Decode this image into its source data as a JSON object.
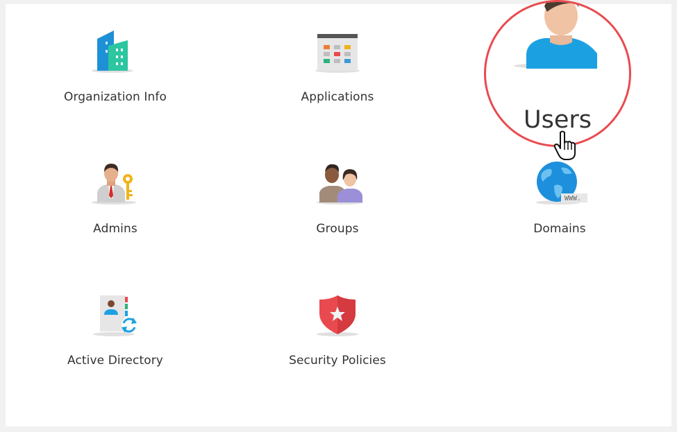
{
  "tiles": [
    {
      "label": "Organization Info",
      "icon": "building-icon"
    },
    {
      "label": "Applications",
      "icon": "applications-grid-icon"
    },
    {
      "label": "Users",
      "icon": "user-icon"
    },
    {
      "label": "Admins",
      "icon": "admin-key-icon"
    },
    {
      "label": "Groups",
      "icon": "group-icon"
    },
    {
      "label": "Domains",
      "icon": "globe-www-icon"
    },
    {
      "label": "Active Directory",
      "icon": "directory-sync-icon"
    },
    {
      "label": "Security Policies",
      "icon": "security-shield-icon"
    }
  ],
  "domains_tag": "WWW.",
  "colors": {
    "highlight_circle": "#e94a4f",
    "user_blue": "#1ba1e2",
    "shield_red": "#e84a4f"
  }
}
